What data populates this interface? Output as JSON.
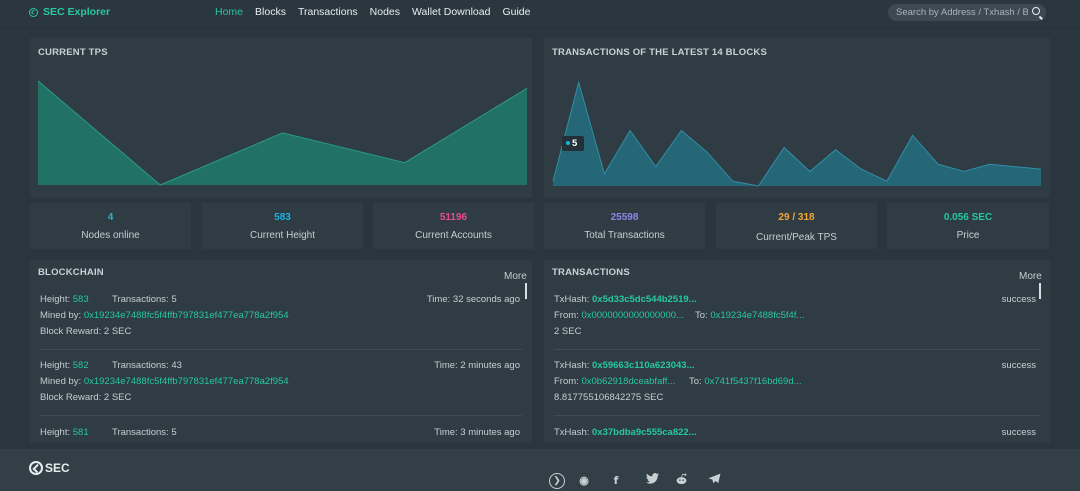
{
  "header": {
    "brand": "SEC Explorer",
    "nav": [
      "Home",
      "Blocks",
      "Transactions",
      "Nodes",
      "Wallet Download",
      "Guide"
    ],
    "active_nav": "Home",
    "search_placeholder": "Search by Address / Txhash / Block"
  },
  "tps_panel": {
    "title": "CURRENT TPS"
  },
  "tx_panel": {
    "title": "TRANSACTIONS OF THE LATEST 14 BLOCKS",
    "tooltip_value": "5"
  },
  "stats": [
    {
      "value": "4",
      "label": "Nodes online",
      "color": "#24b8c9"
    },
    {
      "value": "583",
      "label": "Current Height",
      "color": "#1cb1e0"
    },
    {
      "value": "51196",
      "label": "Current Accounts",
      "color": "#e94c8a"
    },
    {
      "value": "25598",
      "label": "Total Transactions",
      "color": "#8f86e8"
    },
    {
      "value": "29 / 318",
      "label": "Current/Peak TPS",
      "color": "#f0a63a"
    },
    {
      "value": "0.056 SEC",
      "label": "Price",
      "color": "#27c7a2"
    }
  ],
  "blockchain": {
    "title": "BLOCKCHAIN",
    "more": "More",
    "labels": {
      "height": "Height:",
      "transactions": "Transactions:",
      "mined_by": "Mined by:",
      "reward": "Block Reward:",
      "time": "Time:"
    },
    "blocks": [
      {
        "height": "583",
        "transactions": "5",
        "time": "32 seconds ago",
        "miner": "0x19234e7488fc5f4ffb797831ef477ea778a2f954",
        "reward": "2 SEC"
      },
      {
        "height": "582",
        "transactions": "43",
        "time": "2 minutes ago",
        "miner": "0x19234e7488fc5f4ffb797831ef477ea778a2f954",
        "reward": "2 SEC"
      },
      {
        "height": "581",
        "transactions": "5",
        "time": "3 minutes ago"
      }
    ]
  },
  "transactions": {
    "title": "TRANSACTIONS",
    "more": "More",
    "labels": {
      "txhash": "TxHash:",
      "from": "From:",
      "to": "To:"
    },
    "items": [
      {
        "hash": "0x5d33c5dc544b2519...",
        "status": "success",
        "from": "0x0000000000000000...",
        "to": "0x19234e7488fc5f4f...",
        "amount": "2 SEC"
      },
      {
        "hash": "0x59663c110a623043...",
        "status": "success",
        "from": "0x0b62918dceabfaff...",
        "to": "0x741f5437f16bd69d...",
        "amount": "8.817755106842275 SEC"
      },
      {
        "hash": "0x37bdba9c555ca822...",
        "status": "success"
      }
    ]
  },
  "footer": {
    "logo_text": "SEC",
    "social_icons": [
      "sec-icon",
      "weibo-icon",
      "facebook-icon",
      "twitter-icon",
      "reddit-icon",
      "telegram-icon"
    ]
  },
  "chart_data": [
    {
      "type": "area",
      "x": [
        1,
        2,
        3,
        4,
        5
      ],
      "series": [
        {
          "values": [
            14,
            0,
            7,
            3,
            13
          ]
        }
      ],
      "ylim": [
        0,
        16
      ],
      "grid": false,
      "color": "#1e7a6c"
    },
    {
      "type": "area",
      "x": [
        1,
        2,
        3,
        4,
        5,
        6,
        7,
        8,
        9,
        10,
        11,
        12,
        13,
        14,
        15,
        16,
        17,
        18,
        19,
        20
      ],
      "series": [
        {
          "values": [
            2,
            43,
            5,
            23,
            8,
            23,
            14,
            2,
            0,
            16,
            6,
            15,
            7,
            2,
            21,
            9,
            6,
            9,
            8,
            7
          ]
        }
      ],
      "ylim": [
        0,
        46
      ],
      "grid": false,
      "color": "#236d80"
    }
  ]
}
